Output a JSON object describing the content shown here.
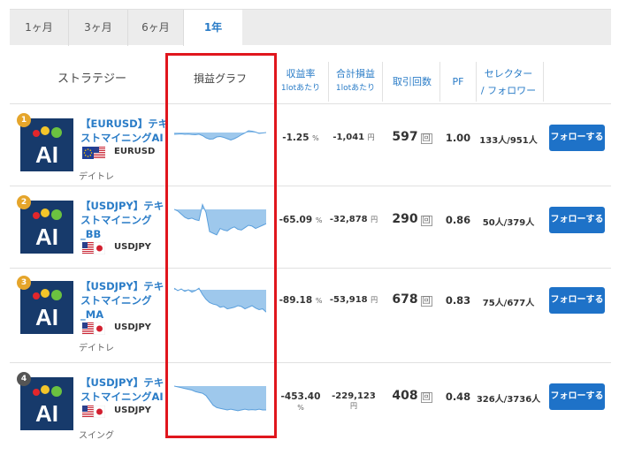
{
  "tabs": [
    {
      "label": "1ヶ月"
    },
    {
      "label": "3ヶ月"
    },
    {
      "label": "6ヶ月"
    },
    {
      "label": "1年",
      "active": true
    }
  ],
  "header": {
    "strategy": "ストラテジー",
    "graph": "損益グラフ",
    "rate": "収益率",
    "rate_sub": "1lotあたり",
    "total": "合計損益",
    "total_sub": "1lotあたり",
    "trades": "取引回数",
    "pf": "PF",
    "selector_line1": "セレクター",
    "selector_line2": "/ フォロワー"
  },
  "logo_text": "AI",
  "follow_label": "フォローする",
  "trades_unit": "回",
  "pct_unit": "%",
  "yen_unit": "円",
  "colors": {
    "accent": "#2a7cc7",
    "button": "#1e72c8",
    "highlight_box": "#e0161d",
    "logo_bg": "#173a6b",
    "graph_fill": "#9ec8ec",
    "graph_line": "#5a9fdc"
  },
  "rows": [
    {
      "rank": "1",
      "rank_color": "#e5a52b",
      "name_line1": "【EURUSD】テキ",
      "name_line2": "ストマイニングAI",
      "name_line3": "",
      "pair": "EURUSD",
      "flag": "eu-us-flag-icon",
      "type": "デイトレ",
      "rate": "-1.25",
      "total": "-1,041",
      "trades": "597",
      "pf": "1.00",
      "selector": "133人/951人",
      "graph": [
        0.2,
        0.18,
        0.15,
        0.2,
        0.17,
        0.22,
        0.25,
        0.19,
        0.35,
        0.6,
        0.75,
        0.72,
        0.5,
        0.45,
        0.55,
        0.7,
        0.85,
        0.7,
        0.5,
        0.25,
        0.05,
        -0.2,
        -0.15,
        -0.05,
        0.1,
        0.05,
        0.0
      ]
    },
    {
      "rank": "2",
      "rank_color": "#e5a52b",
      "name_line1": "【USDJPY】テキ",
      "name_line2": "ストマイニング",
      "name_line3": "_BB",
      "pair": "USDJPY",
      "flag": "us-jp-flag-icon",
      "type": "",
      "rate": "-65.09",
      "total": "-32,878",
      "trades": "290",
      "pf": "0.86",
      "selector": "50人/379人",
      "graph": [
        0,
        0.1,
        0.3,
        0.5,
        0.6,
        0.55,
        0.65,
        0.7,
        -0.3,
        0.2,
        1.4,
        1.5,
        1.6,
        1.2,
        1.3,
        1.35,
        1.2,
        1.1,
        1.25,
        1.3,
        1.15,
        1.0,
        1.05,
        1.2,
        1.1,
        1.0,
        0.9
      ]
    },
    {
      "rank": "3",
      "rank_color": "#e5a52b",
      "name_line1": "【USDJPY】テキ",
      "name_line2": "ストマイニング",
      "name_line3": "_MA",
      "pair": "USDJPY",
      "flag": "us-jp-flag-icon",
      "type": "デイトレ",
      "rate": "-89.18",
      "total": "-53,918",
      "trades": "678",
      "pf": "0.83",
      "selector": "75人/677人",
      "graph": [
        -0.1,
        0.05,
        -0.05,
        0.1,
        0.0,
        0.15,
        0.05,
        -0.1,
        0.3,
        0.6,
        0.8,
        0.9,
        0.95,
        1.1,
        1.05,
        1.2,
        1.15,
        1.1,
        1.0,
        1.05,
        1.2,
        1.1,
        1.0,
        1.15,
        1.25,
        1.2,
        1.4
      ]
    },
    {
      "rank": "4",
      "rank_color": "#555555",
      "name_line1": "【USDJPY】テキ",
      "name_line2": "ストマイニングAI",
      "name_line3": "",
      "pair": "USDJPY",
      "flag": "us-jp-flag-icon",
      "type": "スイング",
      "rate": "-453.40",
      "total": "-229,123",
      "trades": "408",
      "pf": "0.48",
      "selector": "326人/3736人",
      "graph": [
        0,
        0.05,
        0.1,
        0.15,
        0.2,
        0.25,
        0.35,
        0.4,
        0.45,
        0.6,
        0.9,
        1.2,
        1.35,
        1.4,
        1.45,
        1.5,
        1.45,
        1.5,
        1.55,
        1.5,
        1.45,
        1.5,
        1.48,
        1.5,
        1.45,
        1.5,
        1.5
      ]
    }
  ]
}
